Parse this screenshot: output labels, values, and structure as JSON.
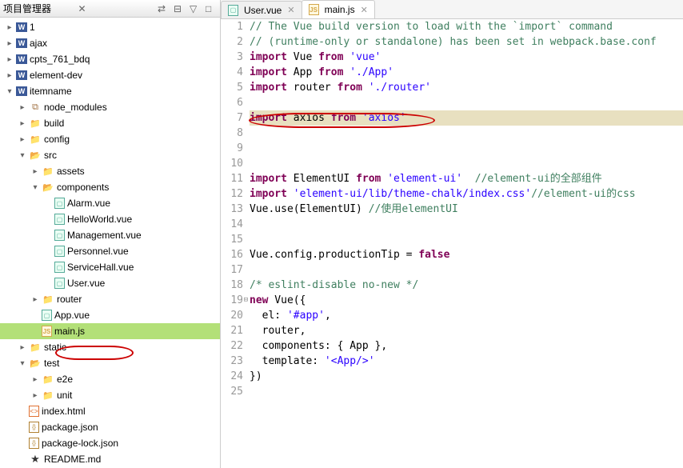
{
  "sidebar": {
    "title": "项目管理器",
    "close_x": "✕"
  },
  "tree": [
    {
      "indent": 0,
      "arrow": ">",
      "icon": "w",
      "label": "1"
    },
    {
      "indent": 0,
      "arrow": ">",
      "icon": "w",
      "label": "ajax"
    },
    {
      "indent": 0,
      "arrow": ">",
      "icon": "w",
      "label": "cpts_761_bdq"
    },
    {
      "indent": 0,
      "arrow": ">",
      "icon": "w",
      "label": "element-dev"
    },
    {
      "indent": 0,
      "arrow": "v",
      "icon": "w",
      "label": "itemname"
    },
    {
      "indent": 1,
      "arrow": ">",
      "icon": "package",
      "label": "node_modules"
    },
    {
      "indent": 1,
      "arrow": ">",
      "icon": "folder",
      "label": "build"
    },
    {
      "indent": 1,
      "arrow": ">",
      "icon": "folder",
      "label": "config"
    },
    {
      "indent": 1,
      "arrow": "v",
      "icon": "folder-open",
      "label": "src"
    },
    {
      "indent": 2,
      "arrow": ">",
      "icon": "folder",
      "label": "assets"
    },
    {
      "indent": 2,
      "arrow": "v",
      "icon": "folder-open",
      "label": "components"
    },
    {
      "indent": 3,
      "arrow": "",
      "icon": "vuefile",
      "label": "Alarm.vue"
    },
    {
      "indent": 3,
      "arrow": "",
      "icon": "vuefile",
      "label": "HelloWorld.vue"
    },
    {
      "indent": 3,
      "arrow": "",
      "icon": "vuefile",
      "label": "Management.vue"
    },
    {
      "indent": 3,
      "arrow": "",
      "icon": "vuefile",
      "label": "Personnel.vue"
    },
    {
      "indent": 3,
      "arrow": "",
      "icon": "vuefile",
      "label": "ServiceHall.vue"
    },
    {
      "indent": 3,
      "arrow": "",
      "icon": "vuefile",
      "label": "User.vue"
    },
    {
      "indent": 2,
      "arrow": ">",
      "icon": "folder",
      "label": "router"
    },
    {
      "indent": 2,
      "arrow": "",
      "icon": "vuefile",
      "label": "App.vue"
    },
    {
      "indent": 2,
      "arrow": "",
      "icon": "jsfile",
      "label": "main.js",
      "selected": true
    },
    {
      "indent": 1,
      "arrow": ">",
      "icon": "folder",
      "label": "static"
    },
    {
      "indent": 1,
      "arrow": "v",
      "icon": "folder-open",
      "label": "test"
    },
    {
      "indent": 2,
      "arrow": ">",
      "icon": "folder",
      "label": "e2e"
    },
    {
      "indent": 2,
      "arrow": ">",
      "icon": "folder",
      "label": "unit"
    },
    {
      "indent": 1,
      "arrow": "",
      "icon": "html",
      "label": "index.html"
    },
    {
      "indent": 1,
      "arrow": "",
      "icon": "json",
      "label": "package.json"
    },
    {
      "indent": 1,
      "arrow": "",
      "icon": "json",
      "label": "package-lock.json"
    },
    {
      "indent": 1,
      "arrow": "",
      "icon": "star",
      "label": "README.md"
    }
  ],
  "tabs": [
    {
      "icon": "vuefile",
      "label": "User.vue",
      "active": false
    },
    {
      "icon": "jsfile",
      "label": "main.js",
      "active": true
    }
  ],
  "code": [
    {
      "n": 1,
      "html": "<span class='com'>// The Vue build version to load with the `import` command</span>"
    },
    {
      "n": 2,
      "html": "<span class='com'>// (runtime-only or standalone) has been set in webpack.base.conf</span>"
    },
    {
      "n": 3,
      "html": "<span class='kw'>import</span> Vue <span class='kw'>from</span> <span class='str'>'vue'</span>"
    },
    {
      "n": 4,
      "html": "<span class='kw'>import</span> App <span class='kw'>from</span> <span class='str'>'./App'</span>"
    },
    {
      "n": 5,
      "html": "<span class='kw'>import</span> router <span class='kw'>from</span> <span class='str'>'./router'</span>"
    },
    {
      "n": 6,
      "html": ""
    },
    {
      "n": 7,
      "html": "<span class='kw'>import</span> axios <span class='kw'>from</span> <span class='str'>'axios'</span>",
      "highlight": true
    },
    {
      "n": 8,
      "html": ""
    },
    {
      "n": 9,
      "html": ""
    },
    {
      "n": 10,
      "html": ""
    },
    {
      "n": 11,
      "html": "<span class='kw'>import</span> ElementUI <span class='kw'>from</span> <span class='str'>'element-ui'</span>  <span class='com'>//element-ui的全部组件</span>"
    },
    {
      "n": 12,
      "html": "<span class='kw'>import</span> <span class='str'>'element-ui/lib/theme-chalk/index.css'</span><span class='com'>//element-ui的css</span>"
    },
    {
      "n": 13,
      "html": "Vue.use(ElementUI) <span class='com'>//使用elementUI</span>"
    },
    {
      "n": 14,
      "html": ""
    },
    {
      "n": 15,
      "html": ""
    },
    {
      "n": 16,
      "html": "Vue.config.productionTip = <span class='kw'>false</span>"
    },
    {
      "n": 17,
      "html": ""
    },
    {
      "n": 18,
      "html": "<span class='com'>/* eslint-disable no-new */</span>"
    },
    {
      "n": 19,
      "html": "<span class='kw'>new</span> Vue({",
      "collapse": true
    },
    {
      "n": 20,
      "html": "  el: <span class='str'>'#app'</span>,"
    },
    {
      "n": 21,
      "html": "  router,"
    },
    {
      "n": 22,
      "html": "  components: { App },"
    },
    {
      "n": 23,
      "html": "  template: <span class='str'>'&lt;App/&gt;'</span>"
    },
    {
      "n": 24,
      "html": "})"
    },
    {
      "n": 25,
      "html": ""
    }
  ]
}
